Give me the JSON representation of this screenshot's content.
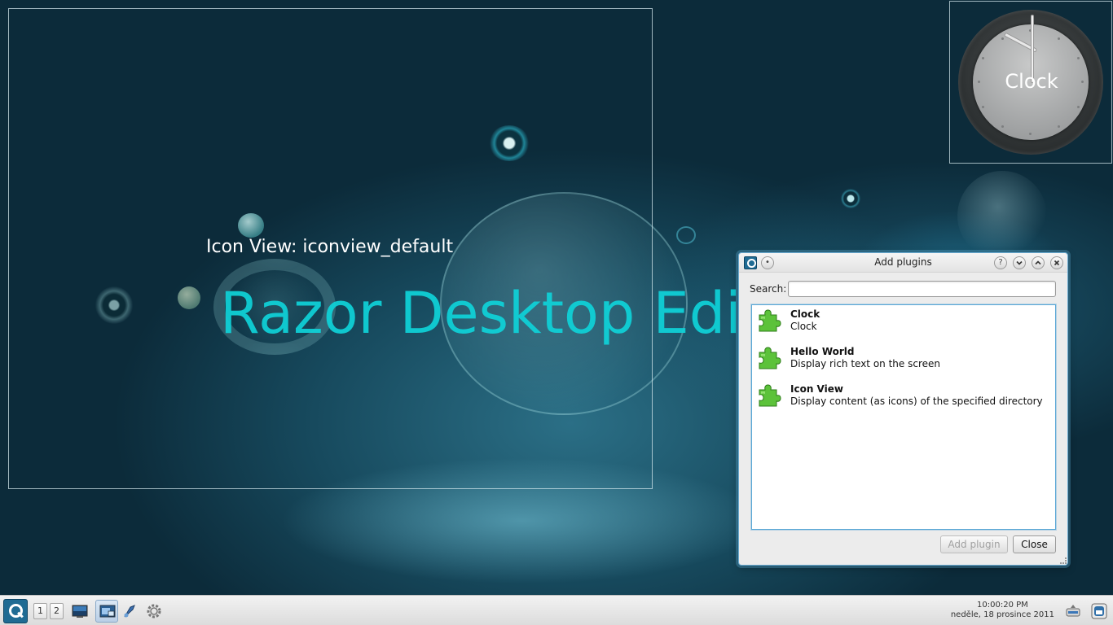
{
  "desktop": {
    "iconview_label": "Icon View: iconview_default",
    "edit_banner": "Razor Desktop Edit"
  },
  "clock_widget": {
    "label": "Clock"
  },
  "dialog": {
    "title": "Add plugins",
    "help_btn": "?",
    "search_label": "Search:",
    "search_value": "",
    "search_placeholder": "",
    "plugins": [
      {
        "name": "Clock",
        "description": "Clock",
        "icon": "puzzle-piece-icon"
      },
      {
        "name": "Hello World",
        "description": "Display rich text on the screen",
        "icon": "puzzle-piece-icon"
      },
      {
        "name": "Icon View",
        "description": "Display content (as icons) of the specified directory",
        "icon": "puzzle-piece-icon"
      }
    ],
    "add_button": "Add plugin",
    "close_button": "Close"
  },
  "taskbar": {
    "desktops": [
      "1",
      "2"
    ],
    "time": "10:00:20 PM",
    "date": "neděle, 18 prosince 2011"
  },
  "colors": {
    "banner": "#0fd3d9",
    "dialog_border": "#6aaad0",
    "accent": "#1f6b93"
  }
}
